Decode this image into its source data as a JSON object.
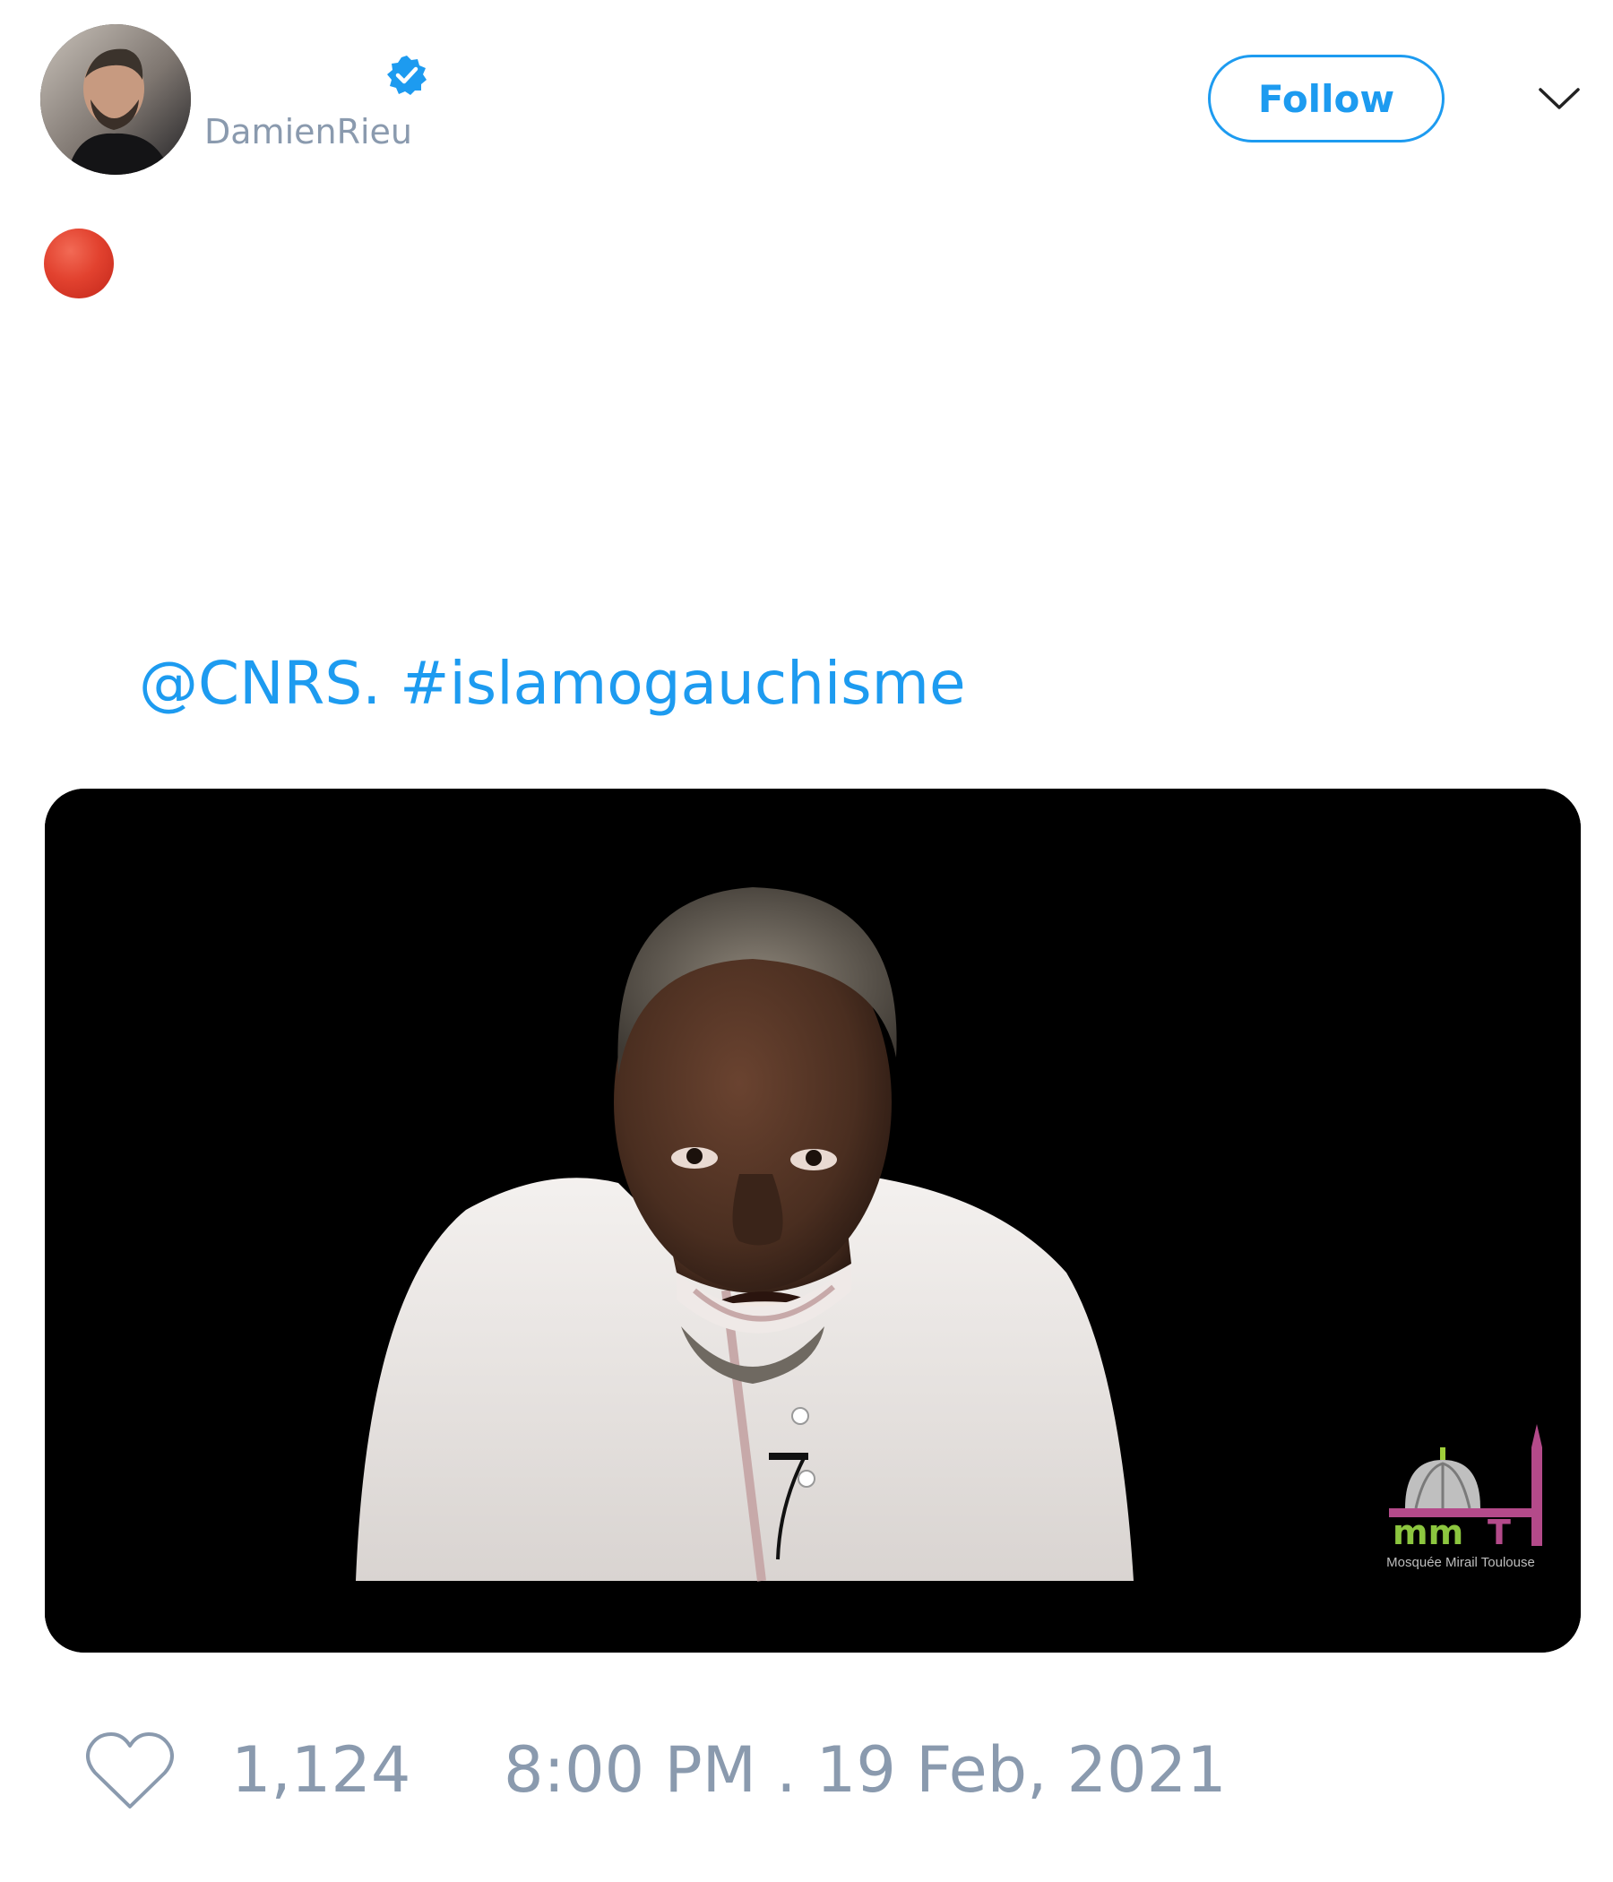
{
  "header": {
    "display_name": "",
    "handle": "DamienRieu",
    "verified": true,
    "follow_label": "Follow",
    "avatar_icon": "user-avatar",
    "menu_icon": "chevron-down-icon"
  },
  "tweet": {
    "emoji": "red-circle",
    "mention": "@CNRS.",
    "hashtag": "#islamogauchisme"
  },
  "media": {
    "type": "video-thumbnail",
    "watermark_caption": "Mosquée Mirail Toulouse"
  },
  "footer": {
    "likes": "1,124",
    "timestamp": "8:00 PM . 19 Feb, 2021",
    "like_icon": "heart-outline-icon"
  },
  "colors": {
    "accent": "#1d9bf0",
    "muted": "#8a9aae",
    "red_dot": "#e2422f"
  }
}
